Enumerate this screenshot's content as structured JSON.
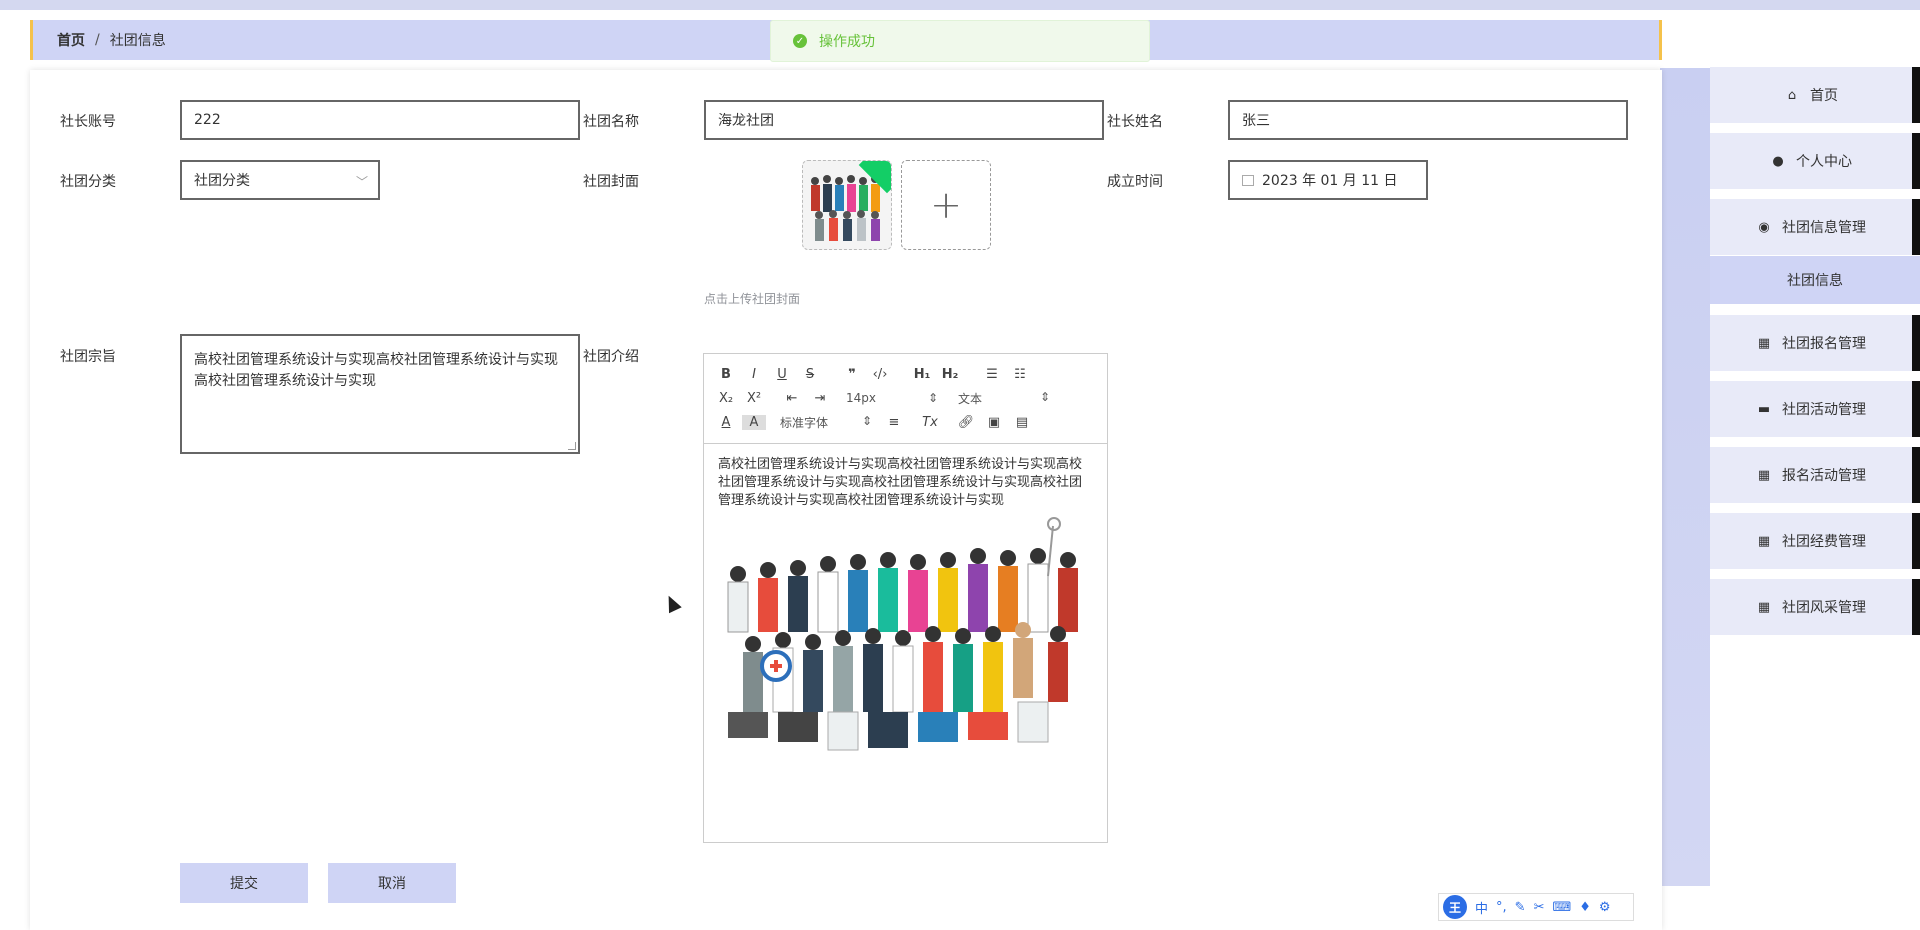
{
  "breadcrumb": {
    "home": "首页",
    "separator": "/",
    "current": "社团信息"
  },
  "toast": {
    "message": "操作成功"
  },
  "form": {
    "president_account_label": "社长账号",
    "president_account_value": "222",
    "club_name_label": "社团名称",
    "club_name_value": "海龙社团",
    "president_name_label": "社长姓名",
    "president_name_value": "张三",
    "category_label": "社团分类",
    "category_value": "社团分类",
    "cover_label": "社团封面",
    "cover_hint": "点击上传社团封面",
    "founded_label": "成立时间",
    "founded_value": "2023 年 01 月 11 日",
    "tenet_label": "社团宗旨",
    "tenet_value": "高校社团管理系统设计与实现高校社团管理系统设计与实现高校社团管理系统设计与实现",
    "intro_label": "社团介绍",
    "intro_text": "高校社团管理系统设计与实现高校社团管理系统设计与实现高校社团管理系统设计与实现高校社团管理系统设计与实现高校社团管理系统设计与实现高校社团管理系统设计与实现",
    "submit_label": "提交",
    "cancel_label": "取消"
  },
  "editor": {
    "font_size": "14px",
    "text_type": "文本",
    "font_family": "标准字体"
  },
  "sidebar": {
    "items": [
      {
        "label": "首页",
        "icon": "home-icon"
      },
      {
        "label": "个人中心",
        "icon": "user-icon"
      },
      {
        "label": "社团信息管理",
        "icon": "location-icon"
      },
      {
        "label": "社团信息",
        "icon": ""
      },
      {
        "label": "社团报名管理",
        "icon": "grid-icon"
      },
      {
        "label": "社团活动管理",
        "icon": "briefcase-icon"
      },
      {
        "label": "报名活动管理",
        "icon": "grid-icon"
      },
      {
        "label": "社团经费管理",
        "icon": "grid-icon"
      },
      {
        "label": "社团风采管理",
        "icon": "grid-icon"
      }
    ]
  },
  "ime": {
    "logo": "王",
    "mode": "中"
  }
}
